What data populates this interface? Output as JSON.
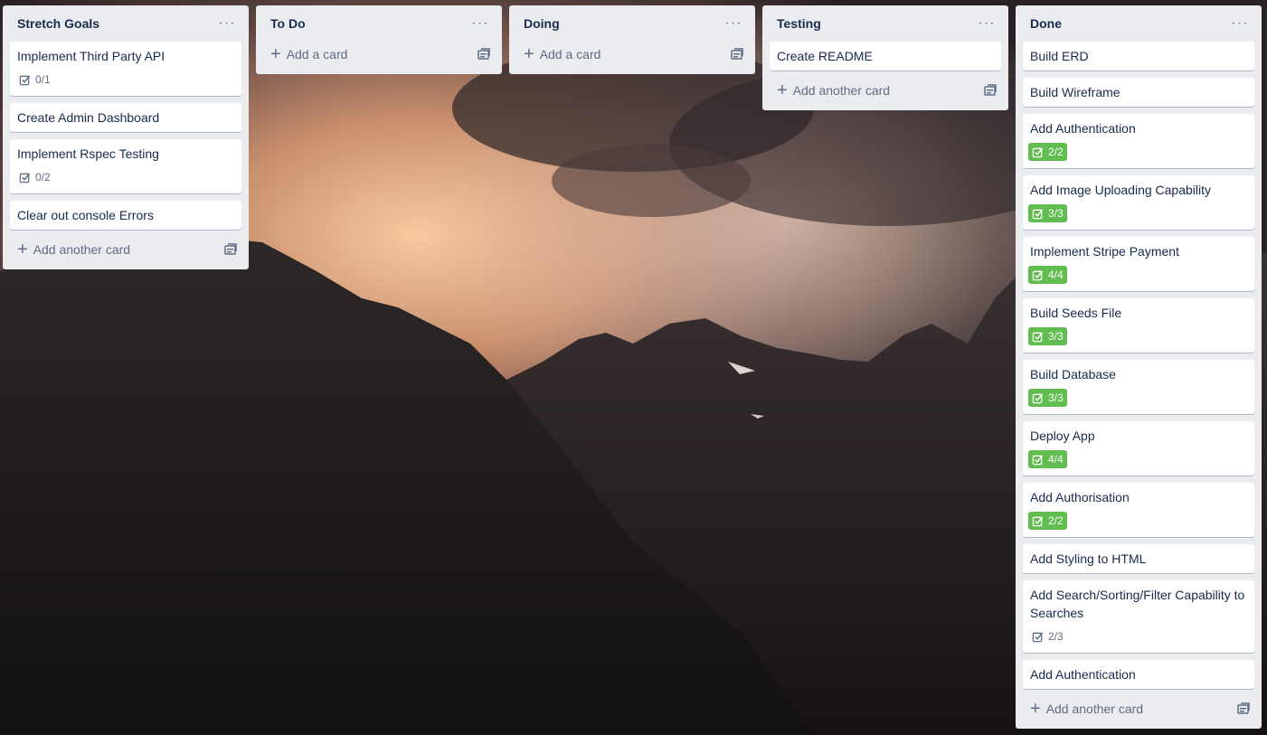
{
  "colors": {
    "list_bg": "#ebecf0",
    "card_bg": "#ffffff",
    "text_primary": "#172b4d",
    "text_muted": "#5e6c84",
    "badge_complete": "#61bd4f"
  },
  "lists": [
    {
      "title": "Stretch Goals",
      "menu": "···",
      "add_label": "Add another card",
      "cards": [
        {
          "title": "Implement Third Party API",
          "checklist": "0/1"
        },
        {
          "title": "Create Admin Dashboard"
        },
        {
          "title": "Implement Rspec Testing",
          "checklist": "0/2"
        },
        {
          "title": "Clear out console Errors"
        }
      ]
    },
    {
      "title": "To Do",
      "menu": "···",
      "add_label": "Add a card",
      "cards": []
    },
    {
      "title": "Doing",
      "menu": "···",
      "add_label": "Add a card",
      "cards": []
    },
    {
      "title": "Testing",
      "menu": "···",
      "add_label": "Add another card",
      "cards": [
        {
          "title": "Create README"
        }
      ]
    },
    {
      "title": "Done",
      "menu": "···",
      "add_label": "Add another card",
      "cards": [
        {
          "title": "Build ERD"
        },
        {
          "title": "Build Wireframe"
        },
        {
          "title": "Add Authentication",
          "checklist": "2/2",
          "complete": true
        },
        {
          "title": "Add Image Uploading Capability",
          "checklist": "3/3",
          "complete": true
        },
        {
          "title": "Implement Stripe Payment",
          "checklist": "4/4",
          "complete": true
        },
        {
          "title": "Build Seeds File",
          "checklist": "3/3",
          "complete": true
        },
        {
          "title": "Build Database",
          "checklist": "3/3",
          "complete": true
        },
        {
          "title": "Deploy App",
          "checklist": "4/4",
          "complete": true
        },
        {
          "title": "Add Authorisation",
          "checklist": "2/2",
          "complete": true
        },
        {
          "title": "Add Styling to HTML"
        },
        {
          "title": "Add Search/Sorting/Filter Capability to Searches",
          "checklist": "2/3"
        },
        {
          "title": "Add Authentication"
        }
      ]
    }
  ]
}
